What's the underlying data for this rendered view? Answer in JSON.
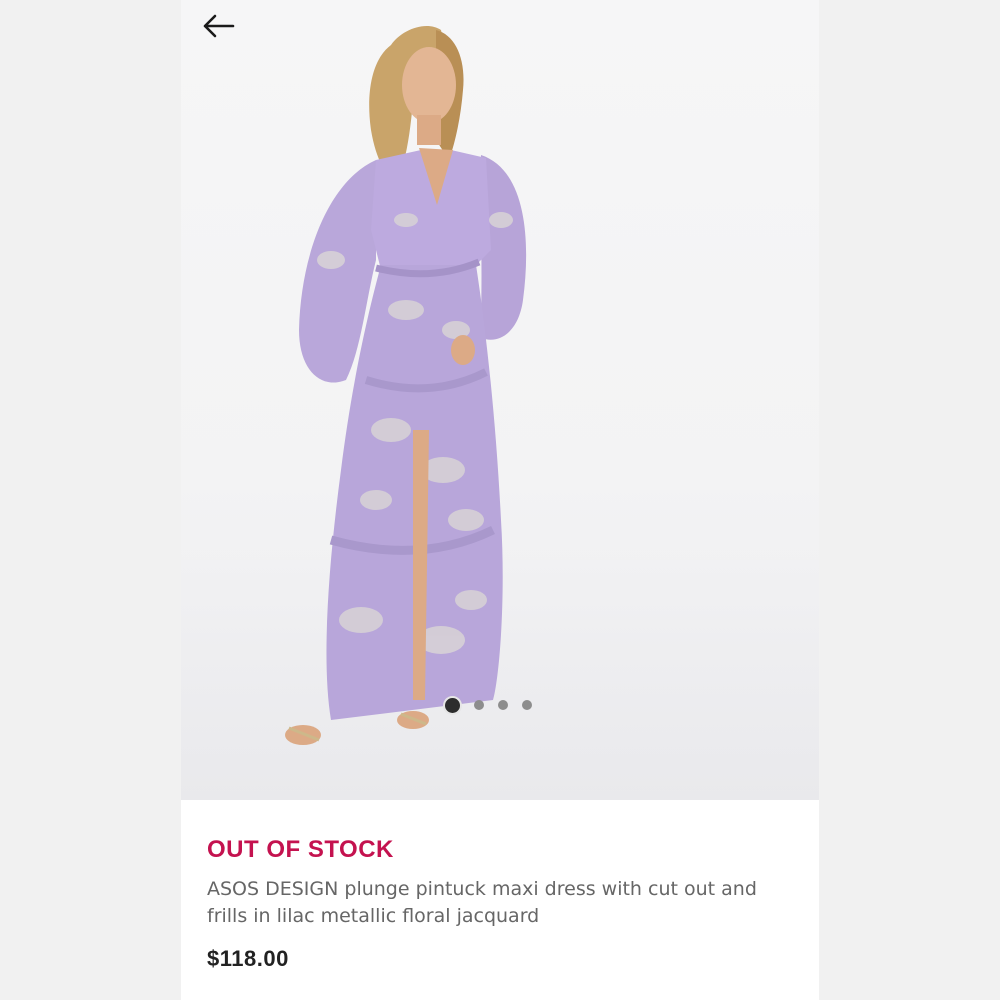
{
  "nav": {
    "back_icon": "arrow-left-icon"
  },
  "carousel": {
    "count": 4,
    "active_index": 0
  },
  "product": {
    "stock_status": "OUT OF STOCK",
    "title": "ASOS DESIGN plunge pintuck maxi dress with cut out and frills in lilac metallic floral jacquard",
    "price": "$118.00"
  },
  "colors": {
    "stock_status": "#c4124f",
    "dress": "#b9a7da",
    "page_bg": "#f1f1f1"
  }
}
